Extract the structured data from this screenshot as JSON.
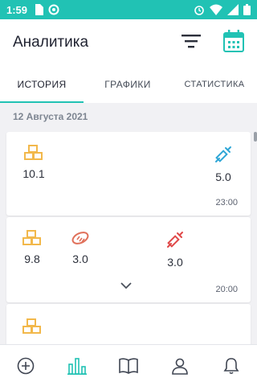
{
  "status_bar": {
    "time": "1:59",
    "icons_left": [
      "sd-card-icon",
      "data-saver-icon"
    ],
    "icons_right": [
      "alarm-icon",
      "wifi-icon",
      "signal-icon",
      "battery-icon"
    ]
  },
  "header": {
    "title": "Аналитика",
    "actions": [
      "filter-icon",
      "calendar-icon"
    ]
  },
  "tabs": [
    {
      "label": "ИСТОРИЯ",
      "active": true
    },
    {
      "label": "ГРАФИКИ",
      "active": false
    },
    {
      "label": "СТАТИСТИКА",
      "active": false
    }
  ],
  "date_header": "12 Августа 2021",
  "entries": [
    {
      "time": "23:00",
      "metrics": [
        {
          "icon": "sugar-cubes-icon",
          "value": "10.1"
        },
        {
          "icon": "insulin-syringe-icon",
          "value": "5.0"
        }
      ]
    },
    {
      "time": "20:00",
      "metrics": [
        {
          "icon": "sugar-cubes-icon",
          "value": "9.8"
        },
        {
          "icon": "bread-icon",
          "value": "3.0"
        },
        {
          "icon": "insulin-syringe-red-icon",
          "value": "3.0"
        }
      ],
      "expand_icon": "chevron-down-icon"
    },
    {
      "metrics": [
        {
          "icon": "sugar-cubes-icon"
        }
      ]
    }
  ],
  "bottom_nav": [
    "add-circle-icon",
    "analytics-bars-icon",
    "book-icon",
    "profile-icon",
    "bell-icon"
  ],
  "colors": {
    "accent": "#21c2b4",
    "sugar": "#f2b84b",
    "bread": "#e0705a",
    "insulin_blue": "#2ea6d6",
    "insulin_red": "#e04848"
  }
}
